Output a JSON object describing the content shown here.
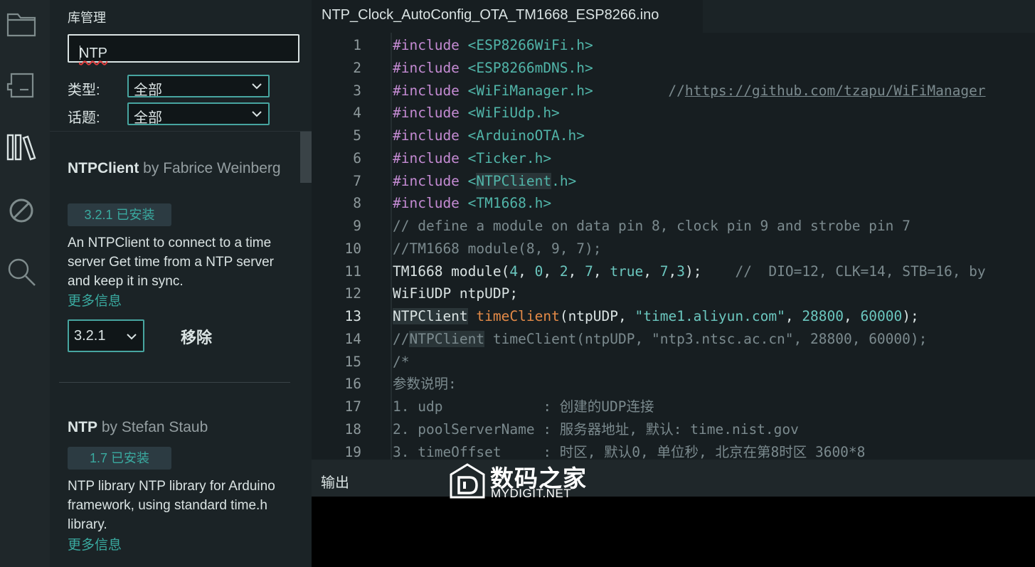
{
  "sidebar": {
    "icons": [
      "folder-icon",
      "board-icon",
      "library-icon",
      "debug-icon",
      "search-icon"
    ],
    "active": "library-icon"
  },
  "library": {
    "title": "库管理",
    "search_value": "NTP",
    "type_label": "类型:",
    "type_value": "全部",
    "topic_label": "话题:",
    "topic_value": "全部",
    "items": [
      {
        "name": "NTPClient",
        "by": " by Fabrice Weinberg",
        "installed_badge": "3.2.1 已安装",
        "description": "An NTPClient to connect to a time server Get time from a NTP server and keep it in sync.",
        "more_info": "更多信息",
        "version_select": "3.2.1",
        "remove_button": "移除"
      },
      {
        "name": "NTP",
        "by": " by Stefan Staub",
        "installed_badge": "1.7 已安装",
        "description": "NTP library NTP library for Arduino framework, using standard time.h library.",
        "more_info": "更多信息"
      }
    ]
  },
  "editor": {
    "tab_title": "NTP_Clock_AutoConfig_OTA_TM1668_ESP8266.ino",
    "current_line": 13,
    "lines": {
      "l1": {
        "kw": "#include",
        "rest": " <ESP8266WiFi.h>"
      },
      "l2": {
        "kw": "#include",
        "rest": " <ESP8266mDNS.h>"
      },
      "l3": {
        "kw": "#include",
        "rest": " <WiFiManager.h>",
        "comment_pad": "         //",
        "url": "https://github.com/tzapu/WiFiManager"
      },
      "l4": {
        "kw": "#include",
        "rest": " <WiFiUdp.h>"
      },
      "l5": {
        "kw": "#include",
        "rest": " <ArduinoOTA.h>"
      },
      "l6": {
        "kw": "#include",
        "rest": " <Ticker.h>"
      },
      "l7": {
        "kw": "#include",
        "rest_a": " <",
        "rest_hl": "NTPClient",
        "rest_b": ".h>"
      },
      "l8": {
        "kw": "#include",
        "rest": " <TM1668.h>"
      },
      "l9": {
        "text": "// define a module on data pin 8, clock pin 9 and strobe pin 7"
      },
      "l10": {
        "text": "//TM1668 module(8, 9, 7);"
      },
      "l11": {
        "a": "TM1668 module(",
        "n1": "4",
        "s1": ", ",
        "n2": "0",
        "s2": ", ",
        "n3": "2",
        "s3": ", ",
        "n4": "7",
        "s4": ", ",
        "tru": "true",
        "s5": ", ",
        "n5": "7",
        "s6": ",",
        "n6": "3",
        "s7": ");",
        "cmt": "    //  DIO=12, CLK=14, STB=16, by"
      },
      "l12": {
        "text": "WiFiUDP ntpUDP;"
      },
      "l13": {
        "cls": "NTPClient",
        "sp": " ",
        "fn": "timeClient",
        "a": "(ntpUDP, ",
        "str": "\"time1.aliyun.com\"",
        "s1": ", ",
        "n1": "28800",
        "s2": ", ",
        "n2": "60000",
        "s3": ");"
      },
      "l14": {
        "pre": "//",
        "hl": "NTPClient",
        "post": " timeClient(ntpUDP, \"ntp3.ntsc.ac.cn\", 28800, 60000);"
      },
      "l15": {
        "text": "/*"
      },
      "l16": {
        "text": "参数说明:"
      },
      "l17": {
        "text": "1. udp            : 创建的UDP连接"
      },
      "l18": {
        "text": "2. poolServerName : 服务器地址, 默认: time.nist.gov"
      },
      "l19": {
        "text": "3. timeOffset     : 时区, 默认0, 单位秒, 北京在第8时区 3600*8"
      }
    }
  },
  "output": {
    "label": "输出"
  },
  "watermark": {
    "cn": "数码之家",
    "en": "MYDIGIT.NET"
  }
}
